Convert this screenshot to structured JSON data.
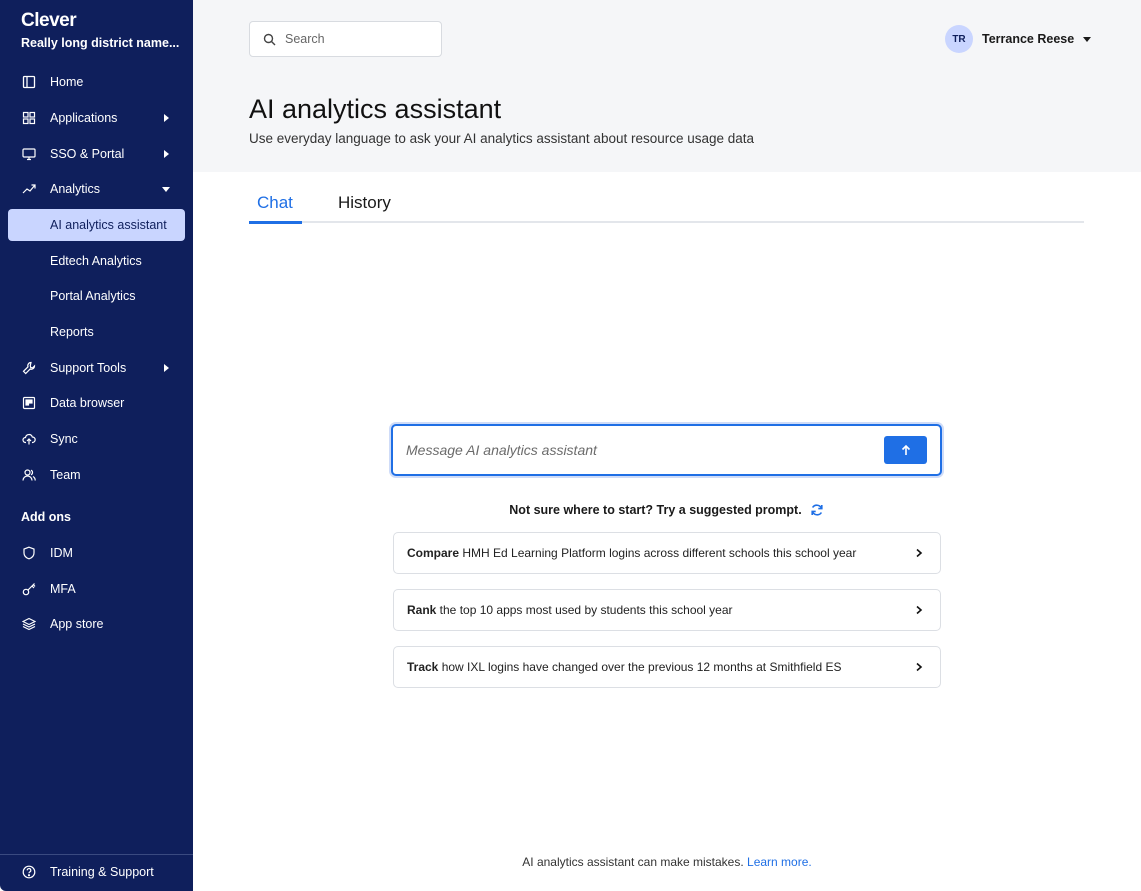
{
  "sidebar": {
    "brand": "Clever",
    "district": "Really long district name...",
    "items": [
      {
        "label": "Home"
      },
      {
        "label": "Applications"
      },
      {
        "label": "SSO & Portal"
      },
      {
        "label": "Analytics"
      },
      {
        "label": "AI analytics assistant"
      },
      {
        "label": "Edtech Analytics"
      },
      {
        "label": "Portal Analytics"
      },
      {
        "label": "Reports"
      },
      {
        "label": "Support Tools"
      },
      {
        "label": "Data browser"
      },
      {
        "label": "Sync"
      },
      {
        "label": "Team"
      }
    ],
    "addons_label": "Add ons",
    "addons": [
      {
        "label": "IDM"
      },
      {
        "label": "MFA"
      },
      {
        "label": "App store"
      }
    ],
    "footer": {
      "label": "Training & Support"
    }
  },
  "header": {
    "search_placeholder": "Search",
    "user_initials": "TR",
    "user_name": "Terrance Reese",
    "title": "AI analytics assistant",
    "subtitle": "Use everyday language to ask your AI analytics assistant about resource usage data"
  },
  "tabs": [
    {
      "label": "Chat"
    },
    {
      "label": "History"
    }
  ],
  "chat": {
    "placeholder": "Message AI analytics assistant",
    "suggest_heading": "Not sure where to start? Try a suggested prompt.",
    "prompts": [
      {
        "verb": "Compare",
        "rest": " HMH Ed Learning Platform logins across different schools this school year"
      },
      {
        "verb": "Rank",
        "rest": " the top 10 apps most used by students this school year"
      },
      {
        "verb": "Track",
        "rest": " how IXL logins have changed over the previous 12 months at Smithfield ES"
      }
    ],
    "disclaimer": "AI analytics assistant can make mistakes.",
    "learn_more": "Learn more."
  },
  "colors": {
    "sidebar_bg": "#0f1f5c",
    "accent": "#1f6fe5",
    "active_nav_bg": "#c9d5ff"
  }
}
